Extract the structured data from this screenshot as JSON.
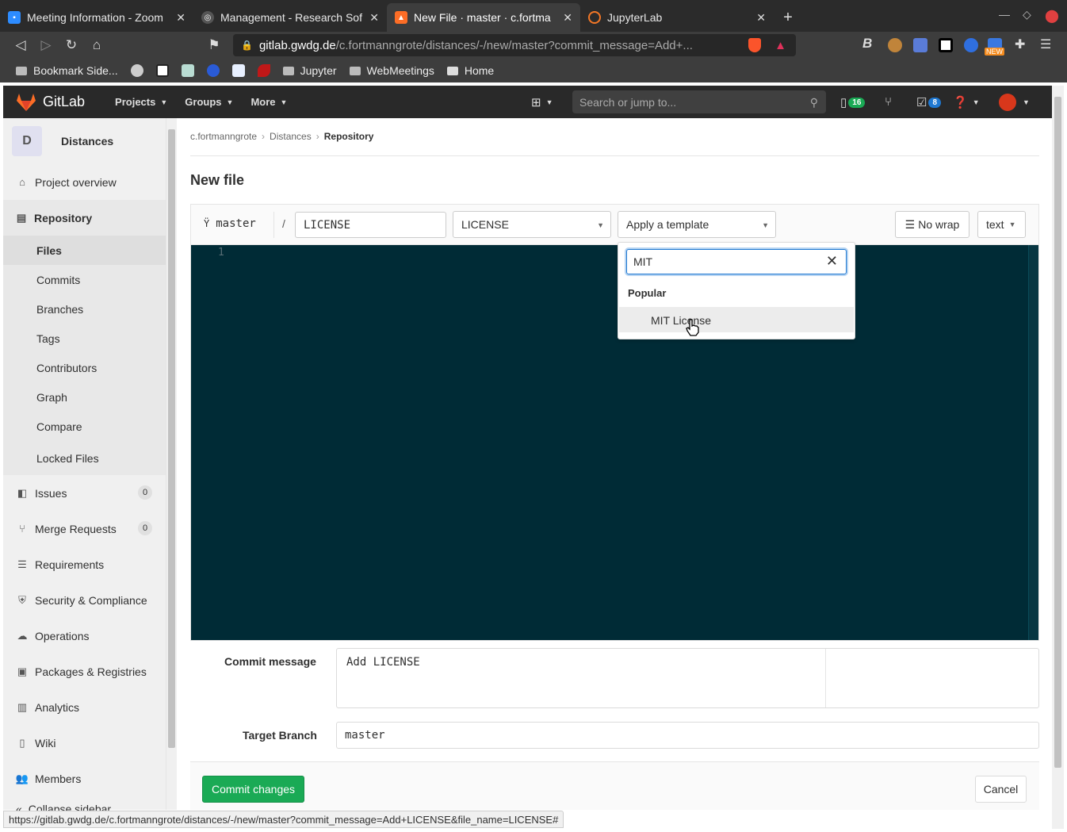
{
  "browser": {
    "tabs": [
      {
        "title": "Meeting Information - Zoom",
        "color": "#2d8cff"
      },
      {
        "title": "Management - Research Sof",
        "color": "#555555"
      },
      {
        "title": "New File · master · c.fortma",
        "color": "#fc6d26"
      },
      {
        "title": "JupyterLab",
        "color": "#f37726"
      }
    ],
    "url_host": "gitlab.gwdg.de",
    "url_path": "/c.fortmanngrote/distances/-/new/master?commit_message=Add+...",
    "bookmarks": [
      "Bookmark Side...",
      "Jupyter",
      "WebMeetings",
      "Home"
    ],
    "ext_new_badge": "NEW"
  },
  "gitlab": {
    "logo": "GitLab",
    "nav": [
      "Projects",
      "Groups",
      "More"
    ],
    "search_placeholder": "Search or jump to...",
    "issues_count": "16",
    "todos_count": "8"
  },
  "sidebar": {
    "project_initial": "D",
    "project_name": "Distances",
    "items": [
      {
        "label": "Project overview",
        "icon": "home-icon"
      },
      {
        "label": "Repository",
        "icon": "book-icon"
      },
      {
        "label": "Issues",
        "icon": "issues-icon",
        "count": "0"
      },
      {
        "label": "Merge Requests",
        "icon": "merge-icon",
        "count": "0"
      },
      {
        "label": "Requirements",
        "icon": "requirements-icon"
      },
      {
        "label": "Security & Compliance",
        "icon": "shield-icon"
      },
      {
        "label": "Operations",
        "icon": "cloud-icon"
      },
      {
        "label": "Packages & Registries",
        "icon": "package-icon"
      },
      {
        "label": "Analytics",
        "icon": "chart-icon"
      },
      {
        "label": "Wiki",
        "icon": "book-icon"
      },
      {
        "label": "Members",
        "icon": "users-icon"
      }
    ],
    "repo_sub": [
      "Files",
      "Commits",
      "Branches",
      "Tags",
      "Contributors",
      "Graph",
      "Compare",
      "Locked Files"
    ],
    "collapse": "Collapse sidebar"
  },
  "main": {
    "breadcrumb": [
      "c.fortmanngrote",
      "Distances",
      "Repository"
    ],
    "title": "New file",
    "branch": "master",
    "filename": "LICENSE",
    "filetype_select": "LICENSE",
    "template_select": "Apply a template",
    "nowrap": "No wrap",
    "mode": "text",
    "line_number": "1",
    "template_search": "MIT",
    "template_group": "Popular",
    "template_option": "MIT License",
    "commit_label": "Commit message",
    "commit_value": "Add LICENSE",
    "target_label": "Target Branch",
    "target_value": "master",
    "commit_button": "Commit changes",
    "cancel_button": "Cancel"
  },
  "status_url": "https://gitlab.gwdg.de/c.fortmanngrote/distances/-/new/master?commit_message=Add+LICENSE&file_name=LICENSE#"
}
